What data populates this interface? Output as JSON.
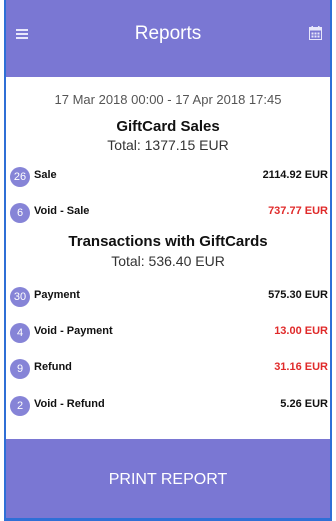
{
  "header": {
    "title": "Reports",
    "menu_icon": "menu-icon",
    "calendar_icon": "calendar-icon"
  },
  "date_range": "17 Mar 2018 00:00 - 17 Apr 2018 17:45",
  "giftcard_sales": {
    "title": "GiftCard Sales",
    "total": "Total: 1377.15 EUR",
    "rows": [
      {
        "count": "26",
        "label": "Sale",
        "value": "2114.92 EUR",
        "value_color": "#111111"
      },
      {
        "count": "6",
        "label": "Void - Sale",
        "value": "737.77 EUR",
        "value_color": "#e02a2a"
      }
    ]
  },
  "transactions": {
    "title": "Transactions with GiftCards",
    "total": "Total: 536.40 EUR",
    "rows": [
      {
        "count": "30",
        "label": "Payment",
        "value": "575.30 EUR",
        "value_color": "#111111"
      },
      {
        "count": "4",
        "label": "Void - Payment",
        "value": "13.00 EUR",
        "value_color": "#e02a2a"
      },
      {
        "count": "9",
        "label": "Refund",
        "value": "31.16 EUR",
        "value_color": "#e02a2a"
      },
      {
        "count": "2",
        "label": "Void - Refund",
        "value": "5.26 EUR",
        "value_color": "#111111"
      }
    ]
  },
  "print_button": "PRINT REPORT",
  "colors": {
    "header_bg": "#7a77d3",
    "badge_bg": "#8684d7",
    "negative": "#e02a2a",
    "frame": "#2f6fd6"
  }
}
